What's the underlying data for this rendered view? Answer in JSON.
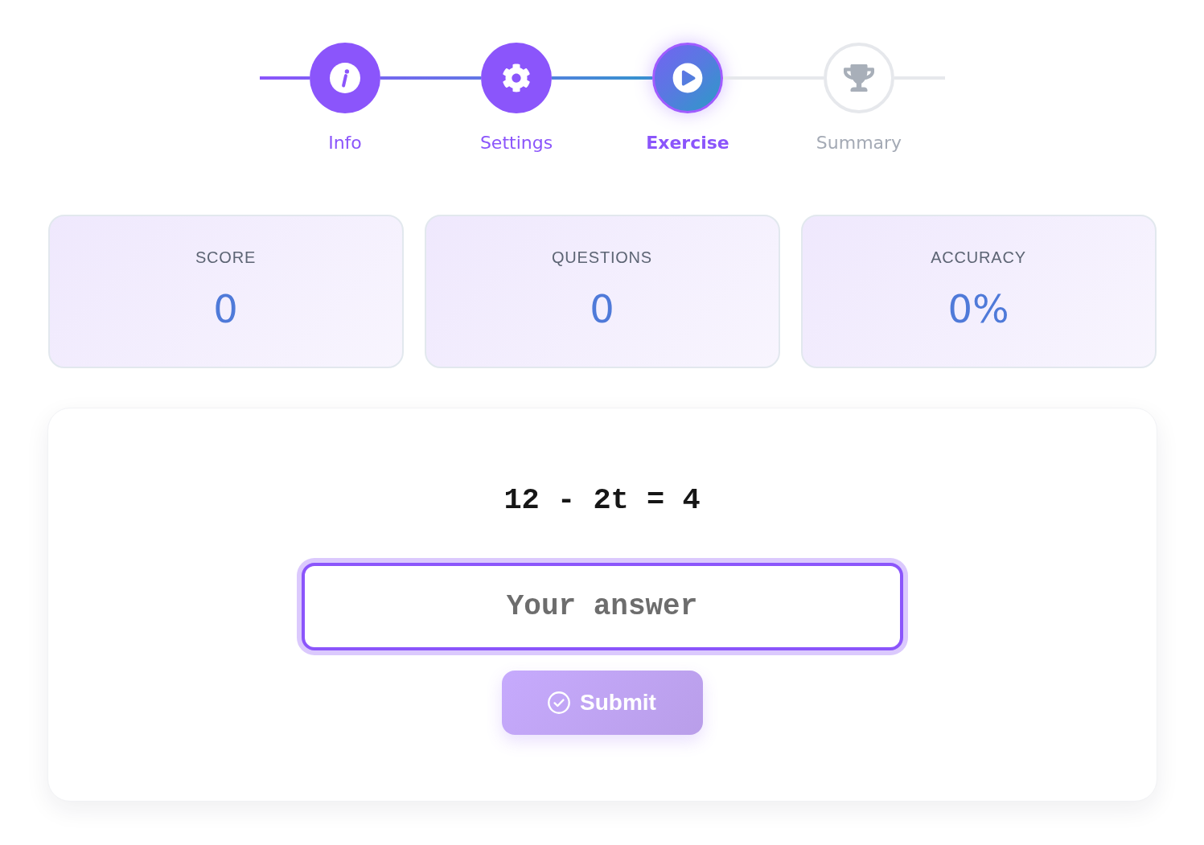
{
  "stepper": {
    "steps": [
      {
        "label": "Info",
        "completed": true,
        "active": false
      },
      {
        "label": "Settings",
        "completed": true,
        "active": false
      },
      {
        "label": "Exercise",
        "completed": false,
        "active": true
      },
      {
        "label": "Summary",
        "completed": false,
        "active": false
      }
    ]
  },
  "stats": [
    {
      "label": "SCORE",
      "value": "0"
    },
    {
      "label": "QUESTIONS",
      "value": "0"
    },
    {
      "label": "ACCURACY",
      "value": "0%"
    }
  ],
  "exercise": {
    "equation": "12 - 2t = 4",
    "answer": {
      "placeholder": "Your answer",
      "focused": true
    },
    "submit": {
      "label": "Submit",
      "disabled": true
    }
  }
}
